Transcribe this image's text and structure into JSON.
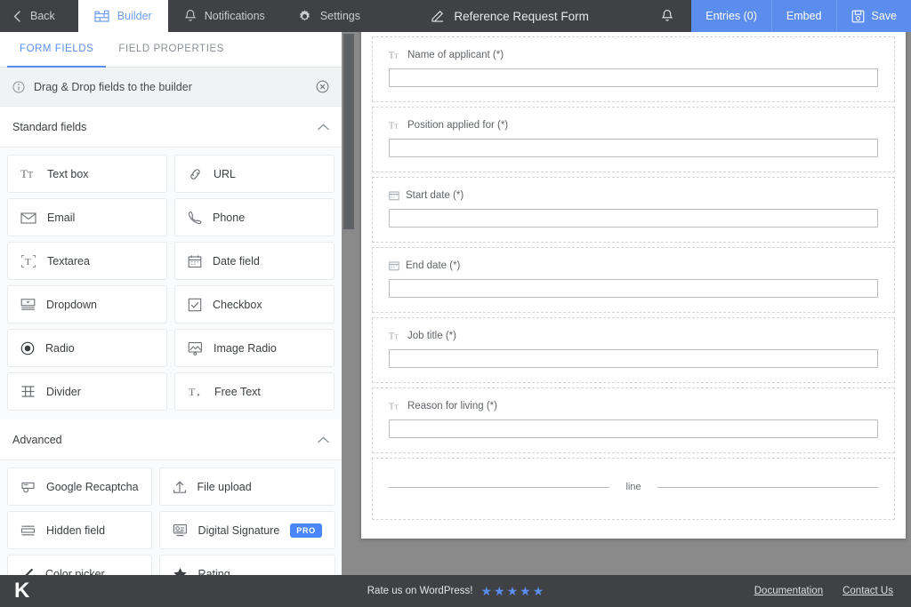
{
  "topbar": {
    "back_label": "Back",
    "items": [
      {
        "label": "Builder",
        "icon": "builder-blocks-icon",
        "active": true
      },
      {
        "label": "Notifications",
        "icon": "bell-icon",
        "active": false
      },
      {
        "label": "Settings",
        "icon": "gear-icon",
        "active": false
      }
    ],
    "form_title": "Reference Request Form",
    "form_title_icon": "edit-pencil-icon",
    "bell_icon": "bell-icon",
    "entries_label": "Entries (0)",
    "embed_label": "Embed",
    "save_label": "Save",
    "save_icon": "floppy-disk-icon",
    "accent_color": "#5b8def",
    "bar_color": "#3f4145"
  },
  "sidebar": {
    "tabs": [
      {
        "label": "FORM FIELDS",
        "active": true
      },
      {
        "label": "FIELD PROPERTIES",
        "active": false
      }
    ],
    "hint": {
      "text": "Drag & Drop fields to the builder",
      "info_icon": "info-circle-icon",
      "close_icon": "close-circle-icon"
    },
    "sections": [
      {
        "title": "Standard fields",
        "chevron": "chevron-up-icon",
        "fields": [
          {
            "label": "Text box",
            "icon": "text-box-icon"
          },
          {
            "label": "URL",
            "icon": "link-icon"
          },
          {
            "label": "Email",
            "icon": "envelope-icon"
          },
          {
            "label": "Phone",
            "icon": "phone-icon"
          },
          {
            "label": "Textarea",
            "icon": "textarea-icon"
          },
          {
            "label": "Date field",
            "icon": "calendar-icon"
          },
          {
            "label": "Dropdown",
            "icon": "dropdown-icon"
          },
          {
            "label": "Checkbox",
            "icon": "checkbox-icon"
          },
          {
            "label": "Radio",
            "icon": "radio-icon"
          },
          {
            "label": "Image Radio",
            "icon": "image-radio-icon"
          },
          {
            "label": "Divider",
            "icon": "divider-icon"
          },
          {
            "label": "Free Text",
            "icon": "free-text-icon"
          }
        ]
      },
      {
        "title": "Advanced",
        "chevron": "chevron-up-icon",
        "fields": [
          {
            "label": "Google Recaptcha",
            "icon": "recaptcha-icon"
          },
          {
            "label": "File upload",
            "icon": "upload-icon"
          },
          {
            "label": "Hidden field",
            "icon": "hidden-field-icon"
          },
          {
            "label": "Digital Signature",
            "icon": "signature-icon",
            "badge": "PRO"
          },
          {
            "label": "Color picker",
            "icon": "pencil-icon"
          },
          {
            "label": "Rating",
            "icon": "star-icon"
          }
        ]
      }
    ]
  },
  "canvas": {
    "blocks": [
      {
        "type": "partial",
        "label": "",
        "icon": ""
      },
      {
        "type": "text",
        "label": "Name of applicant (*)",
        "icon": "text-box-icon",
        "value": ""
      },
      {
        "type": "text",
        "label": "Position applied for (*)",
        "icon": "text-box-icon",
        "value": ""
      },
      {
        "type": "date",
        "label": "Start date (*)",
        "icon": "calendar-icon",
        "value": ""
      },
      {
        "type": "date",
        "label": "End date (*)",
        "icon": "calendar-icon",
        "value": ""
      },
      {
        "type": "text",
        "label": "Job title (*)",
        "icon": "text-box-icon",
        "value": ""
      },
      {
        "type": "text",
        "label": "Reason for living (*)",
        "icon": "text-box-icon",
        "value": ""
      },
      {
        "type": "divider",
        "label": "line",
        "icon": "divider-icon"
      }
    ]
  },
  "footer": {
    "logo": "K",
    "rate_text": "Rate us on WordPress!",
    "stars": 5,
    "star_color": "#5b8def",
    "links": [
      {
        "label": "Documentation"
      },
      {
        "label": "Contact Us"
      }
    ]
  }
}
